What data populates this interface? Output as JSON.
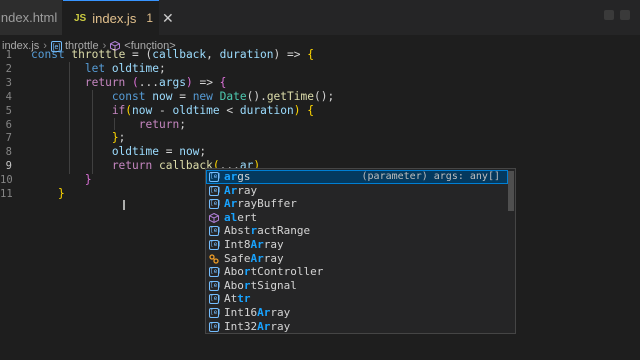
{
  "tabs": [
    {
      "label": "index.html",
      "active": false
    },
    {
      "label": "index.js",
      "active": true,
      "badge": "JS",
      "problems": "1",
      "close": "✕"
    }
  ],
  "breadcrumb": {
    "file": "index.js",
    "symbol": "throttle",
    "scope": "<function>",
    "sep": "›",
    "symbol_icon": "variable-icon",
    "scope_icon": "cube-icon"
  },
  "editor": {
    "line_numbers": [
      "1",
      "2",
      "3",
      "4",
      "5",
      "6",
      "7",
      "8",
      "9",
      "10",
      "11"
    ],
    "active_line": "9",
    "lines": [
      [
        {
          "t": "const ",
          "c": "k"
        },
        {
          "t": "throttle",
          "c": "f"
        },
        {
          "t": " = (",
          "c": "p"
        },
        {
          "t": "callback",
          "c": "v"
        },
        {
          "t": ", ",
          "c": "p"
        },
        {
          "t": "duration",
          "c": "v"
        },
        {
          "t": ") => ",
          "c": "p"
        },
        {
          "t": "{",
          "c": "y"
        }
      ],
      [
        {
          "t": "        let ",
          "c": "k"
        },
        {
          "t": "oldtime",
          "c": "v"
        },
        {
          "t": ";",
          "c": "p"
        }
      ],
      [
        {
          "t": "        return ",
          "c": "c"
        },
        {
          "t": "(",
          "c": "pk"
        },
        {
          "t": "...",
          "c": "p"
        },
        {
          "t": "args",
          "c": "v"
        },
        {
          "t": ")",
          "c": "pk"
        },
        {
          "t": " => ",
          "c": "p"
        },
        {
          "t": "{",
          "c": "pk"
        }
      ],
      [
        {
          "t": "            const ",
          "c": "k"
        },
        {
          "t": "now",
          "c": "v"
        },
        {
          "t": " = ",
          "c": "p"
        },
        {
          "t": "new ",
          "c": "k"
        },
        {
          "t": "Date",
          "c": "t"
        },
        {
          "t": "().",
          "c": "p"
        },
        {
          "t": "getTime",
          "c": "f"
        },
        {
          "t": "();",
          "c": "p"
        }
      ],
      [
        {
          "t": "            if",
          "c": "c"
        },
        {
          "t": "(",
          "c": "y"
        },
        {
          "t": "now",
          "c": "v"
        },
        {
          "t": " - ",
          "c": "p"
        },
        {
          "t": "oldtime",
          "c": "v"
        },
        {
          "t": " < ",
          "c": "p"
        },
        {
          "t": "duration",
          "c": "v"
        },
        {
          "t": ") {",
          "c": "y"
        }
      ],
      [
        {
          "t": "                return",
          "c": "c"
        },
        {
          "t": ";",
          "c": "p"
        }
      ],
      [
        {
          "t": "            }",
          "c": "y"
        },
        {
          "t": ";",
          "c": "p"
        }
      ],
      [
        {
          "t": "            oldtime",
          "c": "v"
        },
        {
          "t": " = ",
          "c": "p"
        },
        {
          "t": "now",
          "c": "v"
        },
        {
          "t": ";",
          "c": "p"
        }
      ],
      [
        {
          "t": "            return ",
          "c": "c"
        },
        {
          "t": "callback",
          "c": "f"
        },
        {
          "t": "(",
          "c": "y"
        },
        {
          "t": "...",
          "c": "p"
        },
        {
          "t": "ar",
          "c": "v"
        },
        {
          "t": ")",
          "c": "y"
        }
      ],
      [
        {
          "t": "        }",
          "c": "pk"
        }
      ],
      [
        {
          "t": "    }",
          "c": "y"
        }
      ]
    ]
  },
  "suggest": {
    "items": [
      {
        "pre": "",
        "hl": "ar",
        "post": "gs",
        "icon": "variable-icon",
        "detail": "(parameter) args: any[]",
        "selected": true
      },
      {
        "pre": "",
        "hl": "Ar",
        "post": "ray",
        "icon": "variable-icon"
      },
      {
        "pre": "",
        "hl": "Ar",
        "post": "rayBuffer",
        "icon": "variable-icon"
      },
      {
        "pre": "",
        "hl": "al",
        "post": "ert",
        "icon": "method-icon"
      },
      {
        "pre": "Abst",
        "hl": "r",
        "post": "actRange",
        "icon": "variable-icon"
      },
      {
        "pre": "Int8",
        "hl": "Ar",
        "post": "ray",
        "icon": "variable-icon"
      },
      {
        "pre": "Safe",
        "hl": "Ar",
        "post": "ray",
        "icon": "class-icon"
      },
      {
        "pre": "Abo",
        "hl": "r",
        "post": "tController",
        "icon": "variable-icon"
      },
      {
        "pre": "Abo",
        "hl": "r",
        "post": "tSignal",
        "icon": "variable-icon"
      },
      {
        "pre": "At",
        "hl": "tr",
        "post": "",
        "icon": "variable-icon"
      },
      {
        "pre": "Int16",
        "hl": "Ar",
        "post": "ray",
        "icon": "variable-icon"
      },
      {
        "pre": "Int32",
        "hl": "Ar",
        "post": "ray",
        "icon": "variable-icon"
      }
    ]
  }
}
